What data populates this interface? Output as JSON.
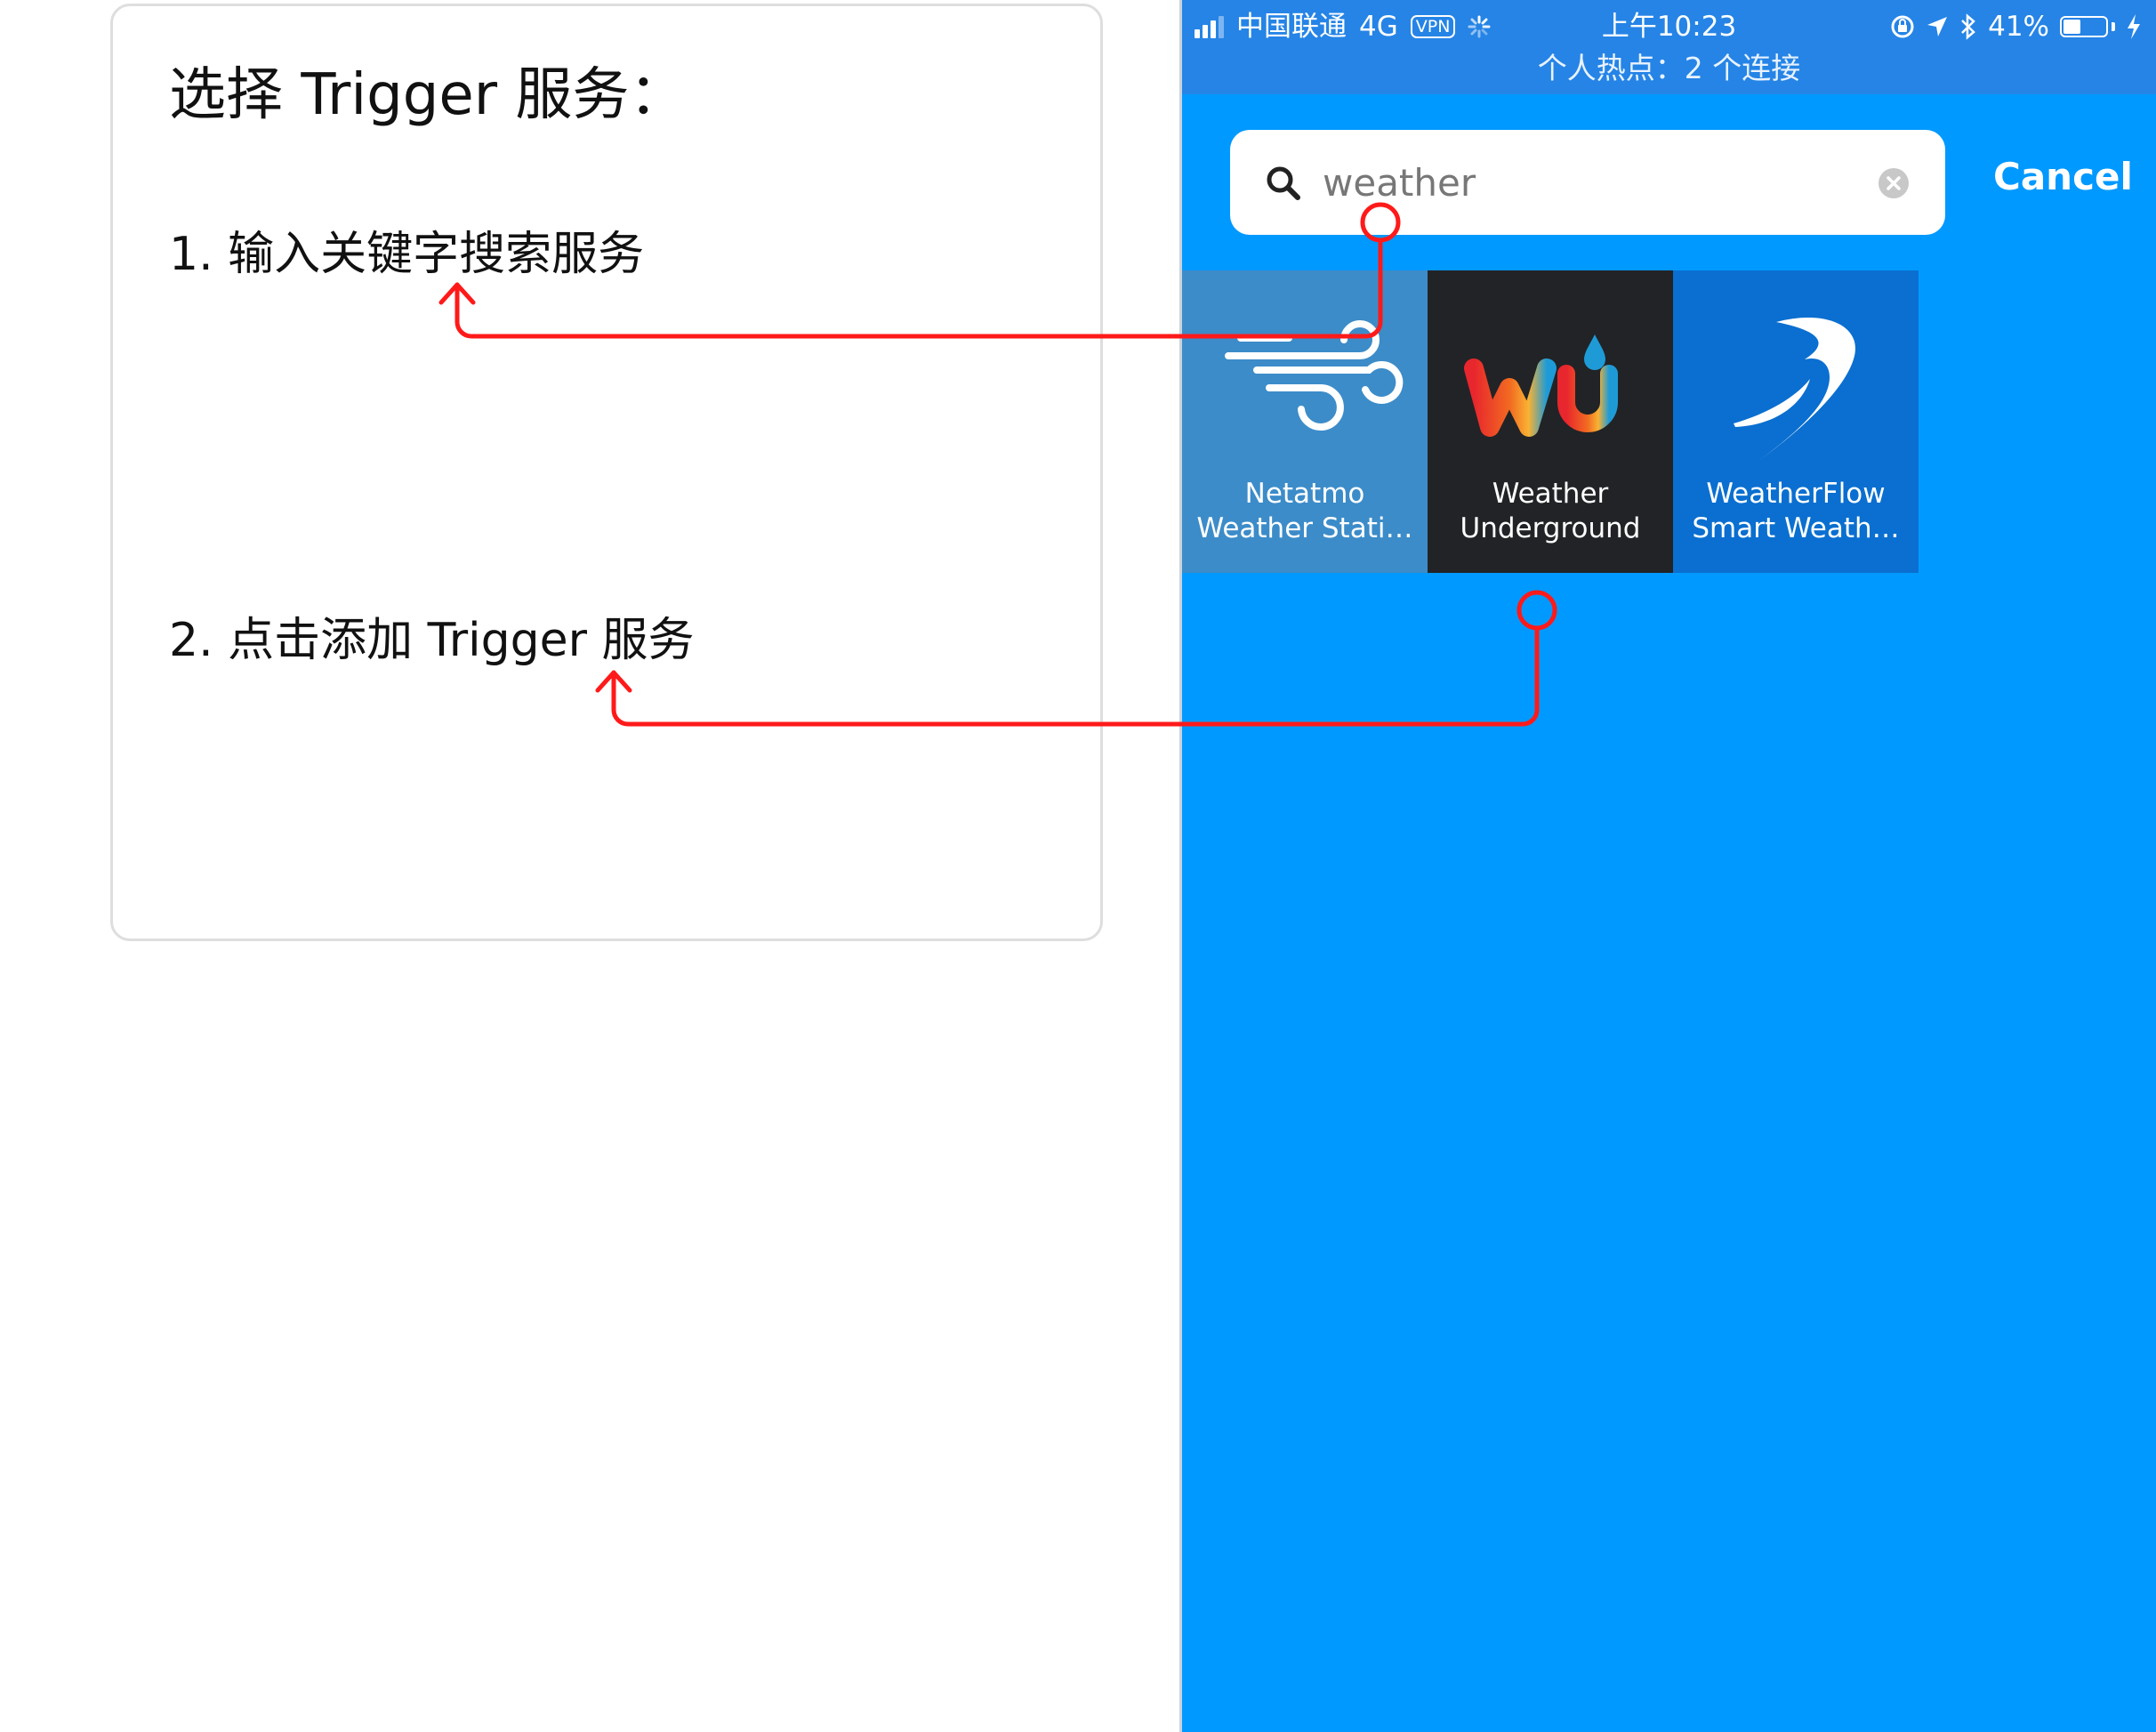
{
  "annotation": {
    "title": "选择 Trigger 服务：",
    "step1": "1. 输入关键字搜索服务",
    "step2": "2. 点击添加 Trigger 服务"
  },
  "status_bar": {
    "carrier": "中国联通",
    "network": "4G",
    "vpn": "VPN",
    "time": "上午10:23",
    "battery": "41%",
    "battery_level": 0.41,
    "hotspot": "个人热点：2 个连接"
  },
  "search": {
    "value": "weather",
    "cancel_label": "Cancel"
  },
  "results": [
    {
      "line1": "Netatmo",
      "line2": "Weather Stati…",
      "icon": "wind-icon",
      "color": "#3c8cc9"
    },
    {
      "line1": "Weather",
      "line2": "Underground",
      "icon": "wu-logo-icon",
      "color": "#222326"
    },
    {
      "line1": "WeatherFlow",
      "line2": "Smart Weath…",
      "icon": "weatherflow-logo-icon",
      "color": "#0a6fd0"
    }
  ],
  "colors": {
    "app_background": "#0099ff",
    "status_bar": "#2584e6",
    "annotation_arrow": "#ff1a1a"
  }
}
